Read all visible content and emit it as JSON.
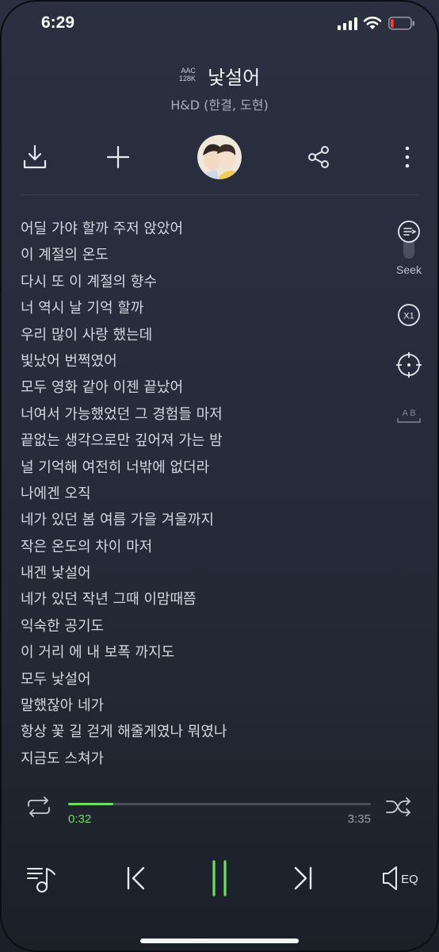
{
  "status_bar": {
    "time": "6:29",
    "battery_level": 0.1
  },
  "header": {
    "codec_line1": "AAC",
    "codec_line2": "128K",
    "title": "낯설어",
    "artist": "H&D (한결, 도현)"
  },
  "actions": [
    "download-icon",
    "add-icon",
    "album-art",
    "share-icon",
    "more-icon"
  ],
  "lyrics": [
    "어딜 가야 할까 주저 앉았어",
    "이 계절의 온도",
    "다시 또 이 계절의 향수",
    "너 역시 날 기억 할까",
    "우리 많이 사랑 했는데",
    "빛났어 번쩍였어",
    "모두 영화 같아 이젠 끝났어",
    "너여서 가능했었던 그 경험들 마저",
    "끝없는 생각으로만 깊어져 가는 밤",
    "널 기억해 여전히 너밖에 없더라",
    "나에겐 오직",
    "네가 있던 봄 여름 가을 겨울까지",
    "작은 온도의 차이 마저",
    "내겐 낯설어",
    "네가 있던 작년 그때 이맘때쯤",
    "익숙한 공기도",
    "이 거리 에 내 보폭 까지도",
    "모두 낯설어",
    "말했잖아 네가",
    "항상 꽃 길 걷게 해줄게였나 뭐였나",
    "지금도 스쳐가"
  ],
  "side_tools": {
    "seek_label": "Seek",
    "speed_label": "X1",
    "ab_label": "A B"
  },
  "progress": {
    "current": "0:32",
    "total": "3:35",
    "fraction": 0.149
  },
  "transport": {
    "eq_label": "EQ"
  },
  "colors": {
    "accent": "#6be05a",
    "background": "#262c3a"
  }
}
